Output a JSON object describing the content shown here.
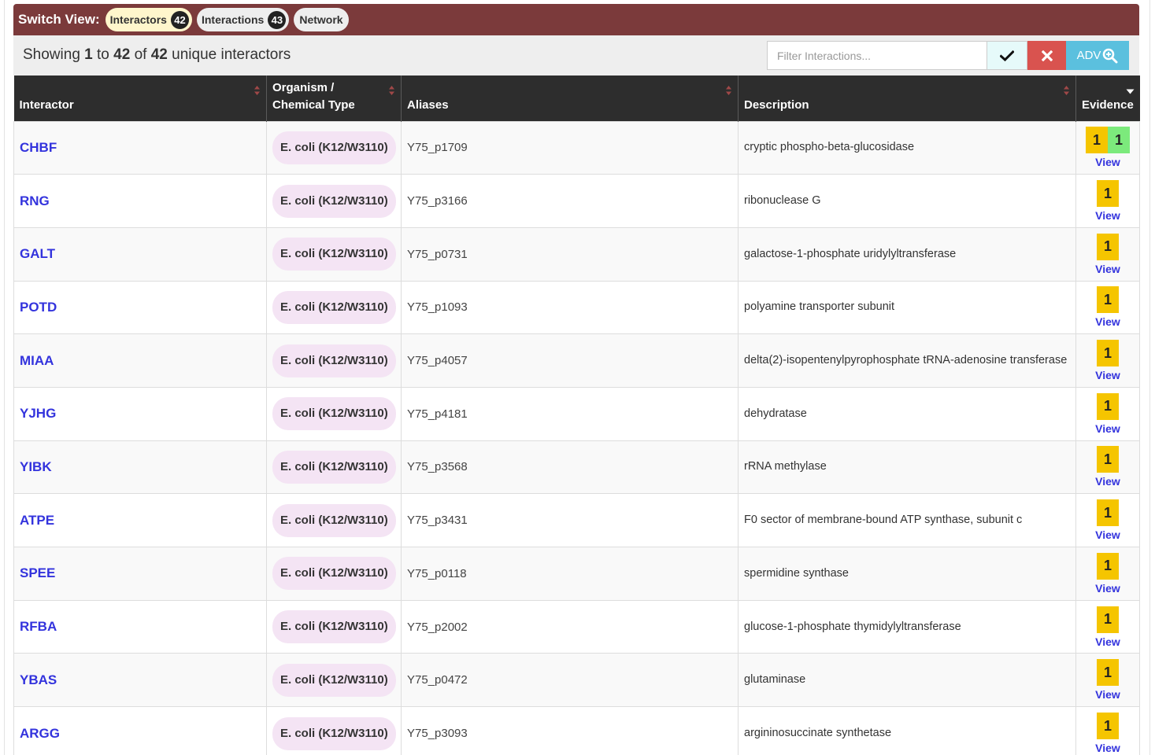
{
  "switch_view": {
    "label": "Switch View:",
    "tabs": [
      {
        "label": "Interactors",
        "count": "42"
      },
      {
        "label": "Interactions",
        "count": "43"
      },
      {
        "label": "Network"
      }
    ]
  },
  "toolbar": {
    "showing_prefix": "Showing",
    "from": "1",
    "to_word": "to",
    "to": "42",
    "of_word": "of",
    "total": "42",
    "suffix": "unique interactors",
    "filter_placeholder": "Filter Interactions...",
    "adv_label": "ADV"
  },
  "table": {
    "headers": {
      "interactor": "Interactor",
      "organism_line1": "Organism /",
      "organism_line2": "Chemical Type",
      "aliases": "Aliases",
      "description": "Description",
      "evidence": "Evidence"
    },
    "view_label": "View",
    "rows": [
      {
        "interactor": "CHBF",
        "organism": "E. coli (K12/W3110)",
        "alias": "Y75_p1709",
        "description": "cryptic phospho-beta-glucosidase",
        "evidence": [
          "1",
          "1"
        ]
      },
      {
        "interactor": "RNG",
        "organism": "E. coli (K12/W3110)",
        "alias": "Y75_p3166",
        "description": "ribonuclease G",
        "evidence": [
          "1"
        ]
      },
      {
        "interactor": "GALT",
        "organism": "E. coli (K12/W3110)",
        "alias": "Y75_p0731",
        "description": "galactose-1-phosphate uridylyltransferase",
        "evidence": [
          "1"
        ]
      },
      {
        "interactor": "POTD",
        "organism": "E. coli (K12/W3110)",
        "alias": "Y75_p1093",
        "description": "polyamine transporter subunit",
        "evidence": [
          "1"
        ]
      },
      {
        "interactor": "MIAA",
        "organism": "E. coli (K12/W3110)",
        "alias": "Y75_p4057",
        "description": "delta(2)-isopentenylpyrophosphate tRNA-adenosine transferase",
        "evidence": [
          "1"
        ]
      },
      {
        "interactor": "YJHG",
        "organism": "E. coli (K12/W3110)",
        "alias": "Y75_p4181",
        "description": "dehydratase",
        "evidence": [
          "1"
        ]
      },
      {
        "interactor": "YIBK",
        "organism": "E. coli (K12/W3110)",
        "alias": "Y75_p3568",
        "description": "rRNA methylase",
        "evidence": [
          "1"
        ]
      },
      {
        "interactor": "ATPE",
        "organism": "E. coli (K12/W3110)",
        "alias": "Y75_p3431",
        "description": "F0 sector of membrane-bound ATP synthase, subunit c",
        "evidence": [
          "1"
        ]
      },
      {
        "interactor": "SPEE",
        "organism": "E. coli (K12/W3110)",
        "alias": "Y75_p0118",
        "description": "spermidine synthase",
        "evidence": [
          "1"
        ]
      },
      {
        "interactor": "RFBA",
        "organism": "E. coli (K12/W3110)",
        "alias": "Y75_p2002",
        "description": "glucose-1-phosphate thymidylyltransferase",
        "evidence": [
          "1"
        ]
      },
      {
        "interactor": "YBAS",
        "organism": "E. coli (K12/W3110)",
        "alias": "Y75_p0472",
        "description": "glutaminase",
        "evidence": [
          "1"
        ]
      },
      {
        "interactor": "ARGG",
        "organism": "E. coli (K12/W3110)",
        "alias": "Y75_p3093",
        "description": "argininosuccinate synthetase",
        "evidence": [
          "1"
        ]
      }
    ]
  },
  "colors": {
    "header_bar": "#7b3a3b",
    "table_header": "#2d2d2d",
    "link": "#3333dd",
    "organism_pill": "#f4e4f4",
    "evidence_yellow": "#f5c500",
    "evidence_green": "#7cea7c",
    "clear_button": "#d9534f",
    "adv_button": "#5bc0de"
  }
}
